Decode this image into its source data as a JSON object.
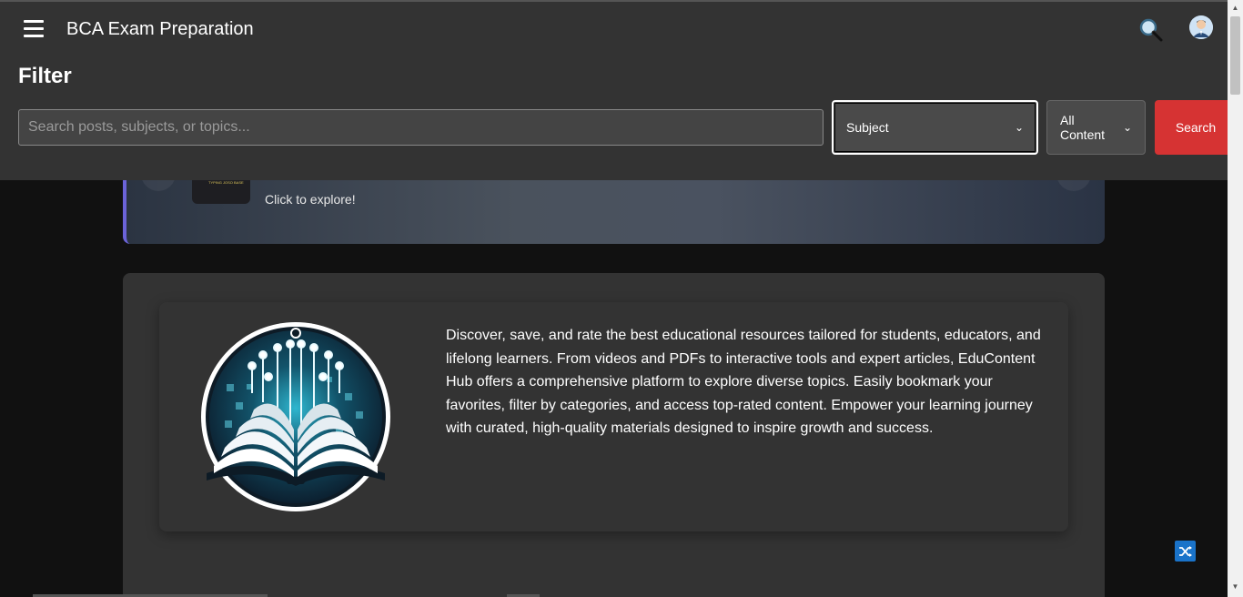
{
  "header": {
    "app_title": "BCA Exam Preparation",
    "menu_icon": "hamburger-menu-icon",
    "search_icon": "magnifier-icon",
    "avatar_icon": "user-avatar-icon"
  },
  "filter": {
    "title": "Filter",
    "search_placeholder": "Search posts, subjects, or topics...",
    "subject_select": "Subject",
    "content_select": "All Content",
    "search_button": "Search"
  },
  "banner": {
    "subtitle": "Click to explore!",
    "thumb_text": "TYPING JOSO BASE"
  },
  "about": {
    "text": "Discover, save, and rate the best educational resources tailored for students, educators, and lifelong learners. From videos and PDFs to interactive tools and expert articles, EduContent Hub offers a comprehensive platform to explore diverse topics. Easily bookmark your favorites, filter by categories, and access top-rated content. Empower your learning journey with curated, high-quality materials designed to inspire growth and success."
  },
  "colors": {
    "header_bg": "#333333",
    "page_bg": "#111111",
    "search_button_bg": "#d63333",
    "banner_accent": "#6b63d9",
    "shuffle_bg": "#1a73c9"
  }
}
